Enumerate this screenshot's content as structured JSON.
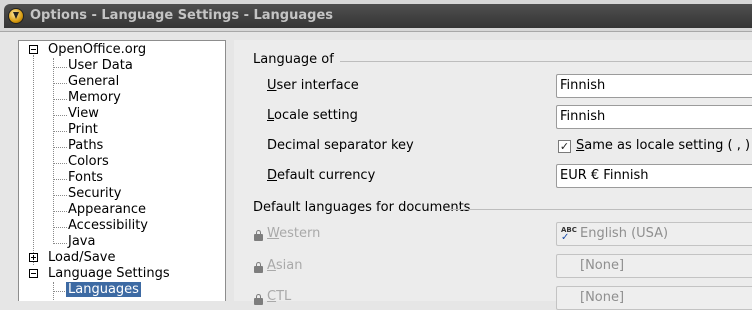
{
  "window": {
    "title": "Options - Language Settings - Languages"
  },
  "tree": {
    "root": "OpenOffice.org",
    "root_children": [
      "User Data",
      "General",
      "Memory",
      "View",
      "Print",
      "Paths",
      "Colors",
      "Fonts",
      "Security",
      "Appearance",
      "Accessibility",
      "Java"
    ],
    "load_save": "Load/Save",
    "language_settings": "Language Settings",
    "languages": "Languages"
  },
  "language_of": {
    "heading": "Language of",
    "user_interface": {
      "label_u": "U",
      "label_rest": "ser interface",
      "value": "Finnish"
    },
    "locale_setting": {
      "label_u": "L",
      "label_rest": "ocale setting",
      "value": "Finnish"
    },
    "decimal_separator": {
      "label": "Decimal separator key",
      "checkbox_u": "S",
      "checkbox_rest": "ame as locale setting ( , )",
      "checked_glyph": "✓"
    },
    "default_currency": {
      "label_u": "D",
      "label_rest": "efault currency",
      "value": "EUR  €  Finnish"
    }
  },
  "default_languages": {
    "heading": "Default languages for documents",
    "western": {
      "label_u": "W",
      "label_rest": "estern",
      "value": "English (USA)",
      "spell_icon_text": "ABC"
    },
    "asian": {
      "label_u": "A",
      "label_rest": "sian",
      "value": "[None]"
    },
    "ctl": {
      "label_u": "C",
      "label_rest": "TL",
      "value": "[None]"
    }
  }
}
